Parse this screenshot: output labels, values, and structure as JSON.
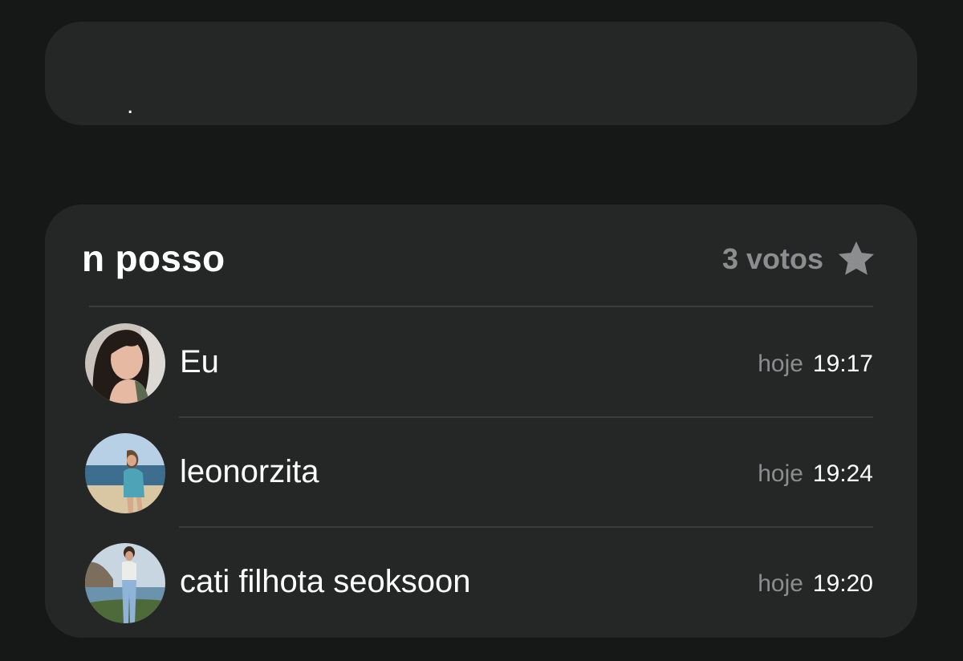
{
  "top_card": {
    "text": "."
  },
  "poll": {
    "option_title": "n posso",
    "votes_label": "3 votos",
    "star_icon": "star-icon",
    "voters": [
      {
        "name": "Eu",
        "day": "hoje",
        "time": "19:17",
        "avatar": "avatar-photo"
      },
      {
        "name": "leonorzita",
        "day": "hoje",
        "time": "19:24",
        "avatar": "avatar-photo"
      },
      {
        "name": "cati filhota seoksoon",
        "day": "hoje",
        "time": "19:20",
        "avatar": "avatar-photo"
      }
    ]
  },
  "colors": {
    "background": "#161717",
    "card": "#252626",
    "divider": "#3b3c3d",
    "muted_text": "#8c8d8e",
    "text": "#ffffff"
  }
}
